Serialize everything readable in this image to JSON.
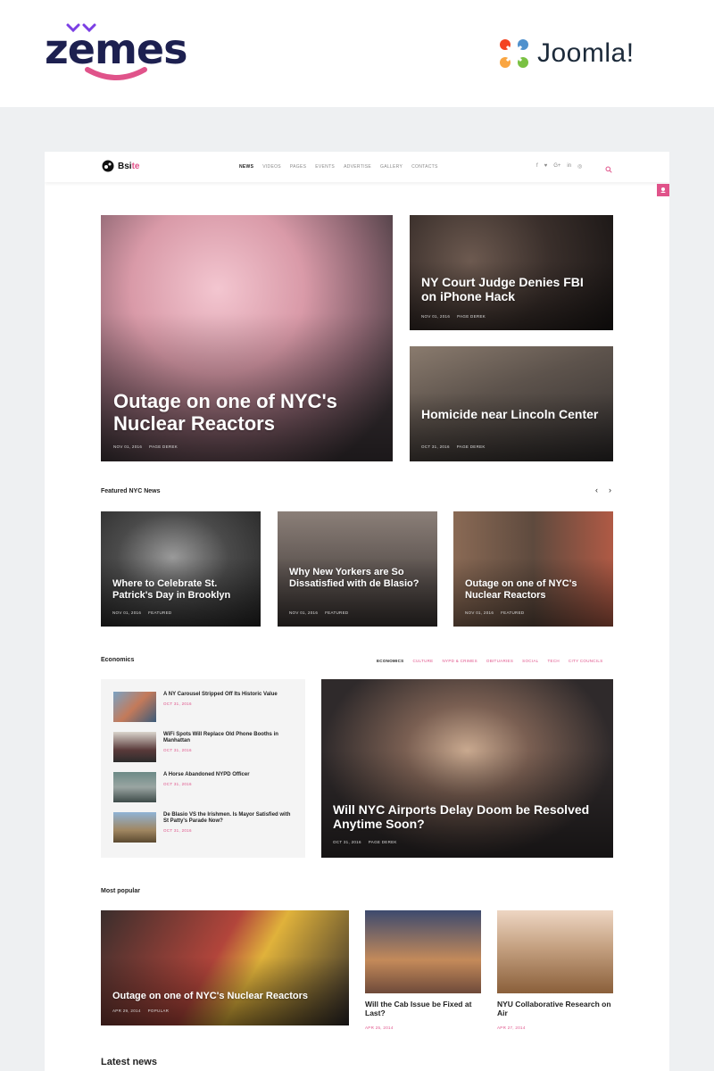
{
  "promo": {
    "zemes_logo": "zemes",
    "joomla_logo": "Joomla!"
  },
  "site": {
    "brand": {
      "prefix": "Bsi",
      "suffix": "te"
    },
    "nav": [
      "NEWS",
      "VIDEOS",
      "PAGES",
      "EVENTS",
      "ADVERTISE",
      "GALLERY",
      "CONTACTS"
    ],
    "social_icons": [
      "facebook-icon",
      "twitter-icon",
      "google-plus-icon",
      "linkedin-icon",
      "pinterest-icon"
    ],
    "colors": {
      "accent": "#e0538a",
      "dark": "#1d2050"
    }
  },
  "hero": {
    "main": {
      "title": "Outage on one of NYC's Nuclear Reactors",
      "date": "NOV 01, 2016",
      "author": "PAGE DEREK"
    },
    "side1": {
      "title": "NY Court Judge Denies FBI on iPhone Hack",
      "date": "NOV 01, 2016",
      "author": "PAGE DEREK"
    },
    "side2": {
      "title": "Homicide near Lincoln Center",
      "date": "OCT 31, 2016",
      "author": "PAGE DEREK"
    }
  },
  "featured": {
    "title": "Featured NYC News",
    "prev": "‹",
    "next": "›",
    "cards": [
      {
        "title": "Where to Celebrate St. Patrick's Day in Brooklyn",
        "date": "NOV 01, 2016",
        "tag": "FEATURED"
      },
      {
        "title": "Why New Yorkers are So Dissatisfied with de Blasio?",
        "date": "NOV 01, 2016",
        "tag": "FEATURED"
      },
      {
        "title": "Outage on one of NYC's Nuclear Reactors",
        "date": "NOV 01, 2016",
        "tag": "FEATURED"
      }
    ]
  },
  "economics": {
    "title": "Economics",
    "filters": [
      "ECONOMICS",
      "CULTURE",
      "NYPD & CRIMES",
      "OBITUARIES",
      "SOCIAL",
      "TECH",
      "CITY COUNCILS"
    ],
    "items": [
      {
        "title": "A NY Carousel Stripped Off Its Historic Value",
        "date": "OCT 31, 2016"
      },
      {
        "title": "WiFi Spots Will Replace Old Phone Booths in Manhattan",
        "date": "OCT 31, 2016"
      },
      {
        "title": "A Horse Abandoned NYPD Officer",
        "date": "OCT 31, 2016"
      },
      {
        "title": "De Blasio VS the Irishmen. Is Mayor Satisfied with St Patty's Parade Now?",
        "date": "OCT 31, 2016"
      }
    ],
    "feature": {
      "title": "Will NYC Airports Delay Doom be Resolved Anytime Soon?",
      "date": "OCT 31, 2016",
      "author": "PAGE DEREK"
    }
  },
  "popular": {
    "title": "Most popular",
    "big": {
      "title": "Outage on one of NYC's Nuclear Reactors",
      "date": "APR 29, 2014",
      "tag": "POPULAR"
    },
    "small": [
      {
        "title": "Will the Cab Issue be Fixed at Last?",
        "date": "APR 25, 2014"
      },
      {
        "title": "NYU Collaborative Research on Air",
        "date": "APR 27, 2014"
      }
    ]
  },
  "latest": {
    "title": "Latest news"
  }
}
